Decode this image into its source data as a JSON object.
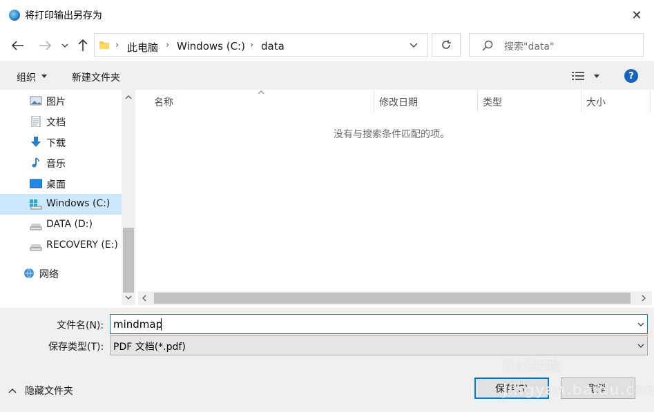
{
  "window": {
    "title": "将打印输出另存为",
    "close_glyph": "✕"
  },
  "address": {
    "crumbs": [
      "此电脑",
      "Windows (C:)",
      "data"
    ],
    "separator": "›"
  },
  "search": {
    "placeholder": "搜索\"data\""
  },
  "toolbar": {
    "organize_label": "组织",
    "new_folder_label": "新建文件夹",
    "help_glyph": "?"
  },
  "nav": {
    "items": [
      {
        "label": "图片",
        "icon": "pictures-icon"
      },
      {
        "label": "文档",
        "icon": "documents-icon"
      },
      {
        "label": "下载",
        "icon": "download-icon"
      },
      {
        "label": "音乐",
        "icon": "music-icon"
      },
      {
        "label": "桌面",
        "icon": "desktop-icon"
      },
      {
        "label": "Windows (C:)",
        "icon": "windows-drive-icon",
        "selected": true
      },
      {
        "label": "DATA (D:)",
        "icon": "drive-icon"
      },
      {
        "label": "RECOVERY (E:)",
        "icon": "drive-icon"
      },
      {
        "label": "网络",
        "icon": "network-icon"
      }
    ]
  },
  "file_list": {
    "columns": [
      "名称",
      "修改日期",
      "类型",
      "大小"
    ],
    "empty_message": "没有与搜索条件匹配的项。"
  },
  "form": {
    "filename_label": "文件名(N):",
    "filename_value": "mindmap",
    "filetype_label": "保存类型(T):",
    "filetype_value": "PDF 文档(*.pdf)"
  },
  "footer": {
    "hide_folders_label": "隐藏文件夹",
    "save_label": "保存(S)",
    "cancel_label": "取消"
  },
  "watermark": {
    "text": "Bai经验 jingyan.baidu.com"
  },
  "colors": {
    "accent": "#0078d7",
    "selection": "#cce8ff",
    "help": "#1565c0"
  }
}
